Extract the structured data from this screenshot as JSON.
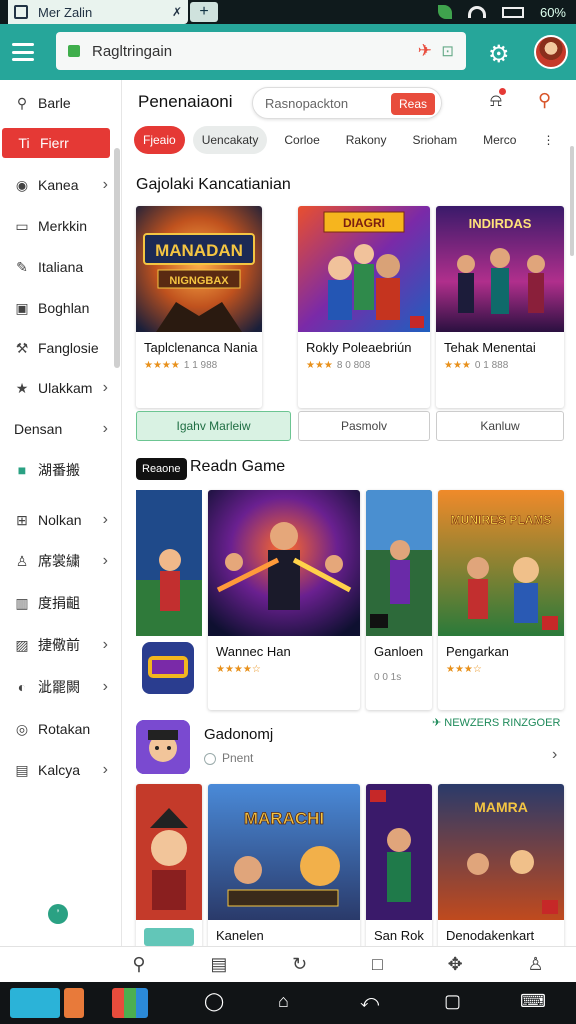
{
  "status": {
    "tab_title": "Mer Zalin",
    "tab_close": "✗",
    "tab_add": "+",
    "battery": "60%"
  },
  "topbar": {
    "url": "Ragltringain",
    "url_icon_a": "✈",
    "url_icon_b": "⊡"
  },
  "sidebar": {
    "items": [
      {
        "label": "Barle",
        "icon": "search-icon",
        "glyph": "⚲",
        "chev": ""
      },
      {
        "label": "Fierr",
        "icon": "tag-icon",
        "glyph": "Ti",
        "chev": ""
      },
      {
        "label": "Kanea",
        "icon": "shield-icon",
        "glyph": "◉",
        "chev": "›"
      },
      {
        "label": "Merkkin",
        "icon": "card-icon",
        "glyph": "▭",
        "chev": ""
      },
      {
        "label": "Italiana",
        "icon": "puzzle-icon",
        "glyph": "✎",
        "chev": ""
      },
      {
        "label": "Boghlan",
        "icon": "box-icon",
        "glyph": "▣",
        "chev": ""
      },
      {
        "label": "Fanglosie",
        "icon": "wrench-icon",
        "glyph": "⚒",
        "chev": ""
      },
      {
        "label": "Ulakkam",
        "icon": "star-icon",
        "glyph": "★",
        "chev": "›"
      },
      {
        "label": "Densan",
        "icon": "",
        "glyph": "",
        "chev": "›"
      },
      {
        "label": "湖番搬",
        "icon": "green-square-icon",
        "glyph": "■",
        "chev": ""
      },
      {
        "label": "Nolkan",
        "icon": "gamepad-icon",
        "glyph": "⊞",
        "chev": "›"
      },
      {
        "label": "席裳繍",
        "icon": "person-icon",
        "glyph": "♙",
        "chev": "›"
      },
      {
        "label": "度捐齟",
        "icon": "chart-icon",
        "glyph": "▥",
        "chev": ""
      },
      {
        "label": "捷儆前",
        "icon": "photo-icon",
        "glyph": "▨",
        "chev": "›"
      },
      {
        "label": "泚罷闕",
        "icon": "target-icon",
        "glyph": "◐",
        "chev": "›"
      },
      {
        "label": "Rotakan",
        "icon": "clock-icon",
        "glyph": "◎",
        "chev": ""
      },
      {
        "label": "Kalcya",
        "icon": "calendar-icon",
        "glyph": "▤",
        "chev": "›"
      }
    ],
    "dot": "’"
  },
  "main": {
    "title": "Penenaiaoni",
    "search_placeholder": "Rasnopackton",
    "search_button": "Reas",
    "chips": [
      "Fjeaio",
      "Uencakaty",
      "Corloe",
      "Rakony",
      "Srioham",
      "Merco",
      "⋮"
    ],
    "sec1_title": "Gajolaki Kancatianian",
    "sec1_cards": [
      {
        "title": "Taplclenanca Nania",
        "meta": "1 1 988",
        "stars": "★★★★",
        "art_text": "MANADAN",
        "art_sub": "NIGNGBAX"
      },
      {
        "title": "Rokly Poleaebriún",
        "meta": "8 0 808",
        "stars": "★★★",
        "art_text": "DIAGRI",
        "art_sub": ""
      },
      {
        "title": "Tehak Menentai",
        "meta": "0 1 888",
        "stars": "★★★",
        "art_text": "INDIRDAS",
        "art_sub": ""
      }
    ],
    "sec1_pills": [
      "Igahv Marleiw",
      "Pasmolv",
      "Kanluw"
    ],
    "sec2_badge": "Reaone",
    "sec2_title": "Readn Game",
    "sec2_cards": [
      {
        "title": "Wannec Han",
        "stars": "★★★★☆",
        "art_text": ""
      },
      {
        "title": "Ganloen",
        "meta": "0 0 1s",
        "art_text": ""
      },
      {
        "title": "Pengarkan",
        "stars": "★★★☆",
        "art_text": "MUNIRES PLAMS"
      }
    ],
    "gd_title": "Gadonomj",
    "gd_sub": "Pnent",
    "gd_link": "✈ NEWZERS RINZGOER",
    "bottom_titles": [
      "",
      "Kanelen",
      "San Rok",
      "Denodakenkart"
    ],
    "bottom_art_text": [
      "",
      "MARACHI",
      "",
      "MAMRA"
    ]
  },
  "colors": {
    "accent": "#26a69a",
    "red": "#e53935",
    "green": "#2aa183"
  }
}
